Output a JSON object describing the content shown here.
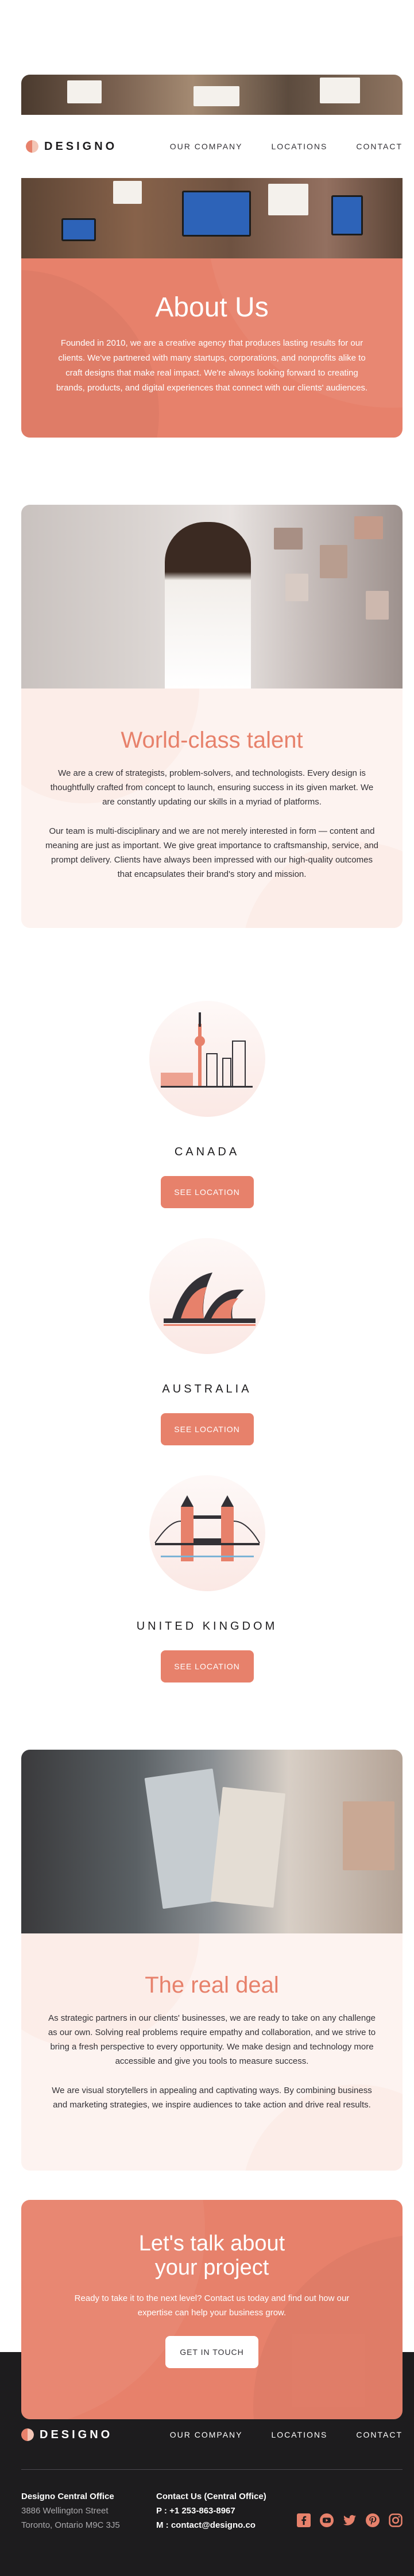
{
  "brand": {
    "name": "DESIGNO",
    "accent": "#e7816b",
    "peach_light": "#fdf3f0",
    "dark": "#1d1c1e"
  },
  "nav": {
    "items": [
      "OUR COMPANY",
      "LOCATIONS",
      "CONTACT"
    ]
  },
  "hero": {
    "title": "About Us",
    "description": "Founded in 2010, we are a creative agency that produces lasting results for our clients. We've partnered with many startups, corporations, and nonprofits alike to craft designs that make real impact. We're always looking forward to creating brands, products, and digital experiences that connect with our clients' audiences."
  },
  "talent": {
    "title": "World-class talent",
    "p1": "We are a crew of strategists, problem-solvers, and technologists. Every design is thoughtfully crafted from concept to launch, ensuring success in its given market. We are constantly updating our skills in a myriad of platforms.",
    "p2": "Our team is multi-disciplinary and we are not merely interested in form — content and meaning are just as important. We give great importance to craftsmanship, service, and prompt delivery. Clients have always been impressed with our high-quality outcomes that encapsulates their brand's story and mission."
  },
  "locations": [
    {
      "name": "CANADA",
      "button": "SEE LOCATION",
      "icon": "toronto-skyline-icon"
    },
    {
      "name": "AUSTRALIA",
      "button": "SEE LOCATION",
      "icon": "sydney-opera-house-icon"
    },
    {
      "name": "UNITED KINGDOM",
      "button": "SEE LOCATION",
      "icon": "tower-bridge-icon"
    }
  ],
  "deal": {
    "title": "The real deal",
    "p1": "As strategic partners in our clients' businesses, we are ready to take on any challenge as our own. Solving real problems require empathy and collaboration, and we strive to bring a fresh perspective to every opportunity. We make design and technology more accessible and give you tools to measure success.",
    "p2": "We are visual storytellers in appealing and captivating ways. By combining business and marketing strategies, we inspire audiences to take action and drive real results."
  },
  "cta": {
    "title_line1": "Let's talk about",
    "title_line2": "your project",
    "description": "Ready to take it to the next level? Contact us today and find out how our expertise can help your business grow.",
    "button": "GET IN TOUCH"
  },
  "footer": {
    "office_heading": "Designo Central Office",
    "office_line1": "3886 Wellington Street",
    "office_line2": "Toronto, Ontario M9C 3J5",
    "contact_heading": "Contact Us (Central Office)",
    "phone": "P : +1 253-863-8967",
    "email": "M : contact@designo.co",
    "social": [
      "facebook-icon",
      "youtube-icon",
      "twitter-icon",
      "pinterest-icon",
      "instagram-icon"
    ]
  }
}
